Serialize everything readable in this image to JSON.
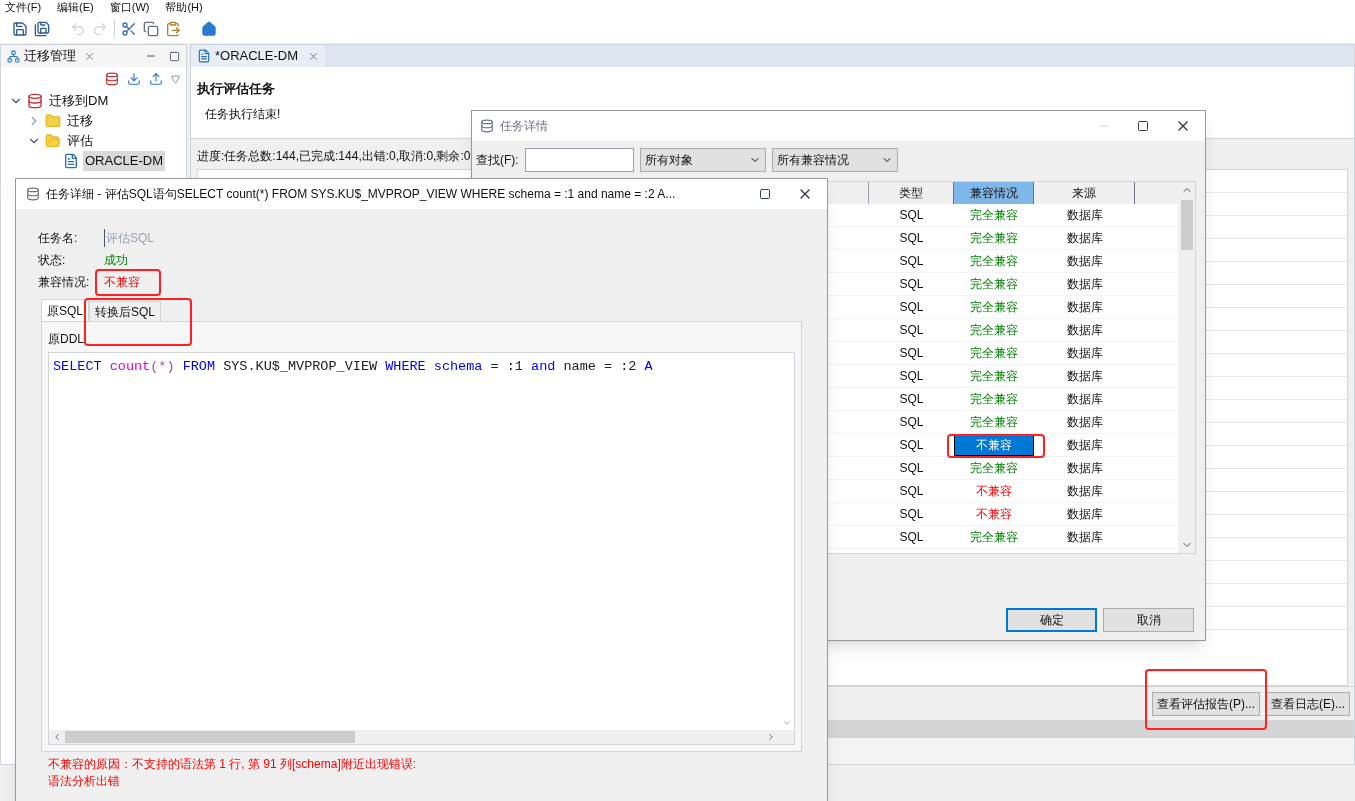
{
  "menu": [
    "文件(F)",
    "编辑(E)",
    "窗口(W)",
    "帮助(H)"
  ],
  "left_panel": {
    "title": "迁移管理",
    "tree": [
      {
        "label": "迁移到DM",
        "kind": "project",
        "expanded": true,
        "selected": false,
        "children": [
          {
            "label": "迁移",
            "kind": "folder",
            "expanded": false,
            "selected": false
          },
          {
            "label": "评估",
            "kind": "folder",
            "expanded": true,
            "selected": false,
            "children": [
              {
                "label": "ORACLE-DM",
                "kind": "file",
                "selected": true
              }
            ]
          }
        ]
      }
    ]
  },
  "editor": {
    "tab": "*ORACLE-DM",
    "heading": "执行评估任务",
    "message": "任务执行结束!",
    "progress": "进度:任务总数:144,已完成:144,出错:0,取消:0,剩余:0",
    "buttons": [
      "查看评估报告(P)...",
      "查看日志(E)..."
    ]
  },
  "task_dialog": {
    "title": "任务详情",
    "find_label": "查找(F):",
    "filters": [
      "所有对象",
      "所有兼容情况"
    ],
    "columns": [
      {
        "label": "类型",
        "sorted": false
      },
      {
        "label": "兼容情况",
        "sorted": true
      },
      {
        "label": "来源",
        "sorted": false
      }
    ],
    "rows": [
      {
        "type": "SQL",
        "compat": "完全兼容",
        "compatible": true,
        "source": "数据库",
        "selected": false
      },
      {
        "type": "SQL",
        "compat": "完全兼容",
        "compatible": true,
        "source": "数据库",
        "selected": false
      },
      {
        "type": "SQL",
        "compat": "完全兼容",
        "compatible": true,
        "source": "数据库",
        "selected": false
      },
      {
        "type": "SQL",
        "compat": "完全兼容",
        "compatible": true,
        "source": "数据库",
        "selected": false
      },
      {
        "type": "SQL",
        "compat": "完全兼容",
        "compatible": true,
        "source": "数据库",
        "selected": false
      },
      {
        "type": "SQL",
        "compat": "完全兼容",
        "compatible": true,
        "source": "数据库",
        "selected": false
      },
      {
        "type": "SQL",
        "compat": "完全兼容",
        "compatible": true,
        "source": "数据库",
        "selected": false
      },
      {
        "type": "SQL",
        "compat": "完全兼容",
        "compatible": true,
        "source": "数据库",
        "selected": false
      },
      {
        "type": "SQL",
        "compat": "完全兼容",
        "compatible": true,
        "source": "数据库",
        "selected": false
      },
      {
        "type": "SQL",
        "compat": "完全兼容",
        "compatible": true,
        "source": "数据库",
        "selected": false
      },
      {
        "type": "SQL",
        "compat": "不兼容",
        "compatible": false,
        "source": "数据库",
        "selected": true
      },
      {
        "type": "SQL",
        "compat": "完全兼容",
        "compatible": true,
        "source": "数据库",
        "selected": false
      },
      {
        "type": "SQL",
        "compat": "不兼容",
        "compatible": false,
        "source": "数据库",
        "selected": false
      },
      {
        "type": "SQL",
        "compat": "不兼容",
        "compatible": false,
        "source": "数据库",
        "selected": false
      },
      {
        "type": "SQL",
        "compat": "完全兼容",
        "compatible": true,
        "source": "数据库",
        "selected": false
      }
    ],
    "buttons": [
      {
        "label": "确定",
        "primary": true
      },
      {
        "label": "取消",
        "primary": false
      }
    ]
  },
  "detail_dialog": {
    "title": "任务详细 - 评估SQL语句SELECT count(*) FROM SYS.KU$_MVPROP_VIEW WHERE schema = :1 and name = :2 A...",
    "fields": [
      {
        "label": "任务名:",
        "value": "评估SQL",
        "kind": "input"
      },
      {
        "label": "状态:",
        "value": "成功",
        "kind": "ok"
      },
      {
        "label": "兼容情况:",
        "value": "不兼容",
        "kind": "error"
      }
    ],
    "tabs": [
      {
        "label": "原SQL",
        "selected": true
      },
      {
        "label": "转换后SQL",
        "selected": false
      }
    ],
    "code_label": "原DDL",
    "code_tokens": [
      {
        "text": "SELECT ",
        "kind": "keyword"
      },
      {
        "text": "count",
        "kind": "function"
      },
      {
        "text": "(*) ",
        "kind": "symbol"
      },
      {
        "text": "FROM ",
        "kind": "keyword"
      },
      {
        "text": "SYS.KU$_MVPROP_VIEW ",
        "kind": "plain"
      },
      {
        "text": "WHERE ",
        "kind": "keyword"
      },
      {
        "text": "schema ",
        "kind": "keyword"
      },
      {
        "text": "= :1 ",
        "kind": "plain"
      },
      {
        "text": "and ",
        "kind": "keyword"
      },
      {
        "text": "name = :2 ",
        "kind": "plain"
      },
      {
        "text": "A",
        "kind": "keyword"
      }
    ],
    "error_lines": [
      "不兼容的原因：不支持的语法第 1 行, 第 91 列[schema]附近出现错误:",
      "语法分析出错"
    ]
  }
}
